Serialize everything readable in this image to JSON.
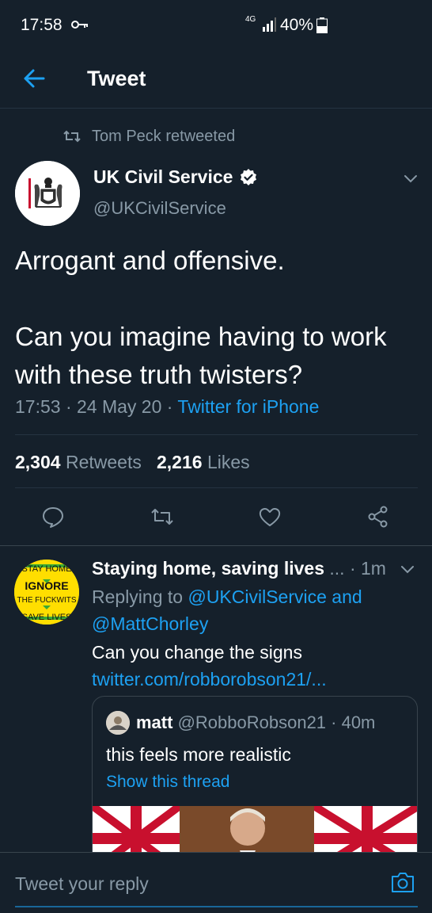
{
  "status_bar": {
    "time": "17:58",
    "network": "4G",
    "battery": "40%"
  },
  "header": {
    "title": "Tweet"
  },
  "tweet": {
    "retweeted_by": "Tom Peck retweeted",
    "author_name": "UK Civil Service",
    "author_handle": "@UKCivilService",
    "text_line1": "Arrogant and offensive.",
    "text_line2": "Can you imagine having to work with these truth twisters?",
    "time_date": "17:53 · 24 May 20 · ",
    "source": "Twitter for iPhone",
    "retweets_count": "2,304",
    "retweets_label": "Retweets",
    "likes_count": "2,216",
    "likes_label": "Likes"
  },
  "reply": {
    "avatar_text": [
      "STAY HOME",
      "IGNORE",
      "THE FUCKWITS",
      "SAVE LIVES"
    ],
    "author_name": "Staying home, saving lives",
    "ellipsis": "...",
    "time": "· 1m",
    "replying_prefix": "Replying to ",
    "replying_to": "@UKCivilService and @MattChorley",
    "text": "Can you change the signs",
    "link": "twitter.com/robborobson21/..."
  },
  "quote": {
    "author_name": "matt",
    "author_meta": "@RobboRobson21 · 40m",
    "text": "this feels more realistic",
    "thread_link": "Show this thread"
  },
  "compose": {
    "placeholder": "Tweet your reply"
  },
  "colors": {
    "background": "#15202b",
    "accent": "#1da1f2",
    "secondary_text": "#8899a6",
    "divider": "#38444d"
  }
}
